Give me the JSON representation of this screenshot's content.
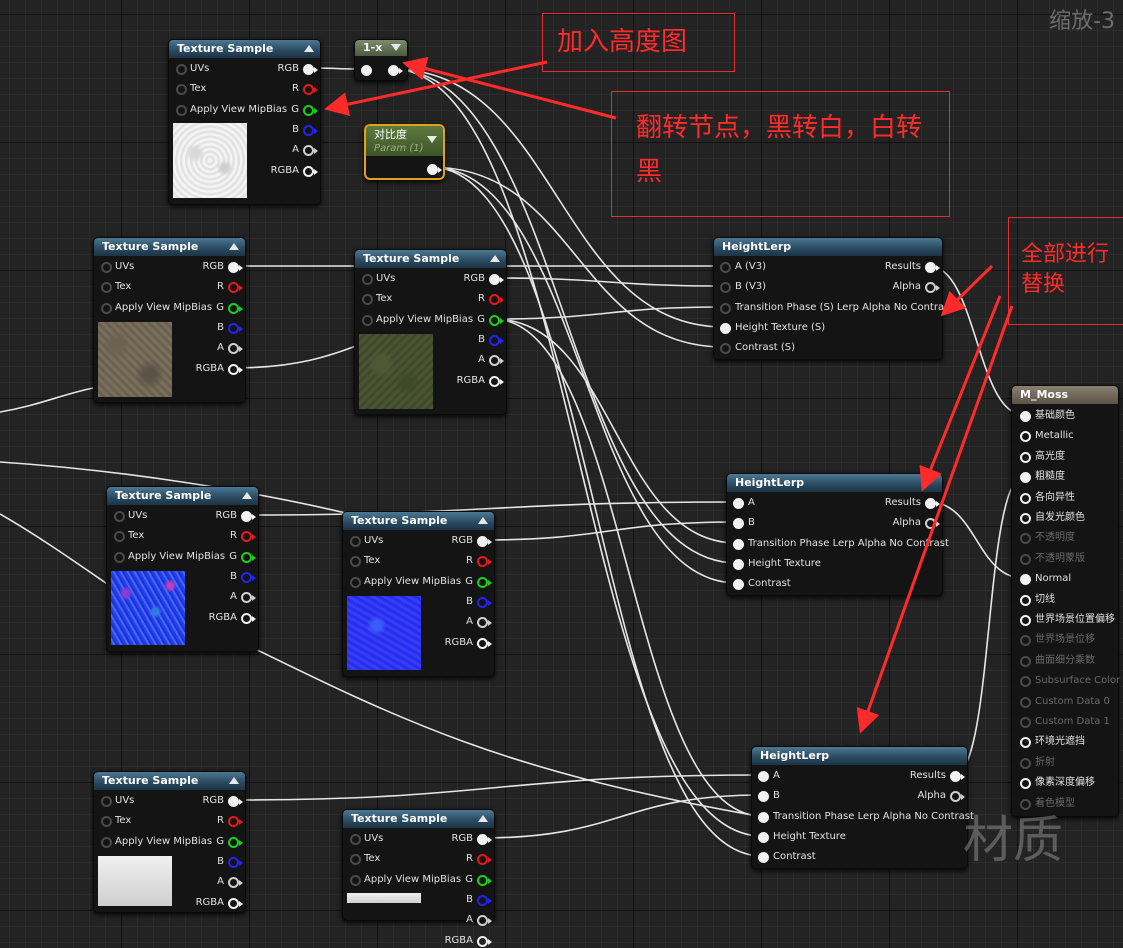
{
  "zoom_label": "缩放-3",
  "watermark": "材质",
  "annotations": {
    "add_height": "加入高度图",
    "invert_note": "翻转节点，黑转白，白转黑",
    "replace_all": "全部进行替换"
  },
  "texture_node": {
    "title": "Texture Sample",
    "uvs": "UVs",
    "tex": "Tex",
    "mip": "Apply View MipBias",
    "rgb": "RGB",
    "r": "R",
    "g": "G",
    "b": "B",
    "a": "A",
    "rgba": "RGBA"
  },
  "oneminus": {
    "title": "1-x"
  },
  "param": {
    "title": "对比度",
    "subtitle": "Param (1)"
  },
  "heightlerp1": {
    "title": "HeightLerp",
    "in_a": "A (V3)",
    "in_b": "B (V3)",
    "in_phase": "Transition Phase (S) Lerp Alpha No Contrast",
    "in_height": "Height Texture (S)",
    "in_contrast": "Contrast (S)",
    "out_results": "Results",
    "out_alpha": "Alpha"
  },
  "heightlerp2": {
    "title": "HeightLerp",
    "in_a": "A",
    "in_b": "B",
    "in_phase": "Transition Phase  Lerp Alpha No Contrast",
    "in_height": "Height Texture",
    "in_contrast": "Contrast",
    "out_results": "Results",
    "out_alpha": "Alpha"
  },
  "heightlerp3": {
    "title": "HeightLerp",
    "in_a": "A",
    "in_b": "B",
    "in_phase": "Transition Phase Lerp Alpha No Contrast",
    "in_height": "Height Texture",
    "in_contrast": "Contrast",
    "out_results": "Results",
    "out_alpha": "Alpha"
  },
  "material": {
    "title": "M_Moss",
    "pins": [
      {
        "label": "基础颜色",
        "active": true
      },
      {
        "label": "Metallic",
        "active": true
      },
      {
        "label": "高光度",
        "active": true
      },
      {
        "label": "粗糙度",
        "active": true
      },
      {
        "label": "各向异性",
        "active": true
      },
      {
        "label": "自发光颜色",
        "active": true
      },
      {
        "label": "不透明度",
        "active": false
      },
      {
        "label": "不透明蒙版",
        "active": false
      },
      {
        "label": "Normal",
        "active": true
      },
      {
        "label": "切线",
        "active": true
      },
      {
        "label": "世界场景位置偏移",
        "active": true
      },
      {
        "label": "世界场景位移",
        "active": false
      },
      {
        "label": "曲面细分乘数",
        "active": false
      },
      {
        "label": "Subsurface Color",
        "active": false
      },
      {
        "label": "Custom Data 0",
        "active": false
      },
      {
        "label": "Custom Data 1",
        "active": false
      },
      {
        "label": "环境光遮挡",
        "active": true
      },
      {
        "label": "折射",
        "active": false
      },
      {
        "label": "像素深度偏移",
        "active": true
      },
      {
        "label": "着色模型",
        "active": false
      }
    ]
  },
  "colors": {
    "accent_red": "#ff2a2a",
    "header_blue": "#2b4c63",
    "param_gold": "#e0a020",
    "wire": "#e6e6e6"
  }
}
